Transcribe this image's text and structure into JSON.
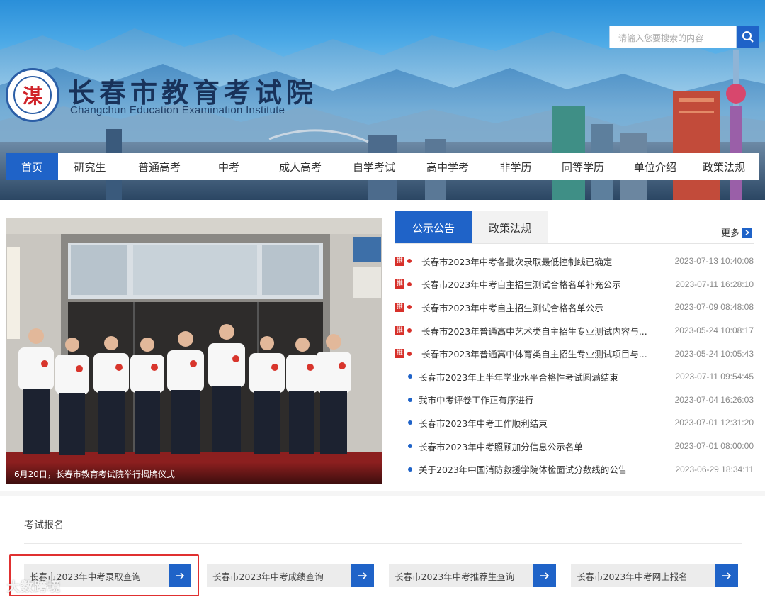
{
  "header": {
    "search_placeholder": "请输入您要搜索的内容",
    "title": "长春市教育考试院",
    "subtitle": "Changchun Education Examination Institute",
    "seal_char": "湈"
  },
  "nav": {
    "items": [
      "首页",
      "研究生",
      "普通高考",
      "中考",
      "成人高考",
      "自学考试",
      "高中学考",
      "非学历",
      "同等学历",
      "单位介绍",
      "政策法规"
    ],
    "active_index": 0
  },
  "photo": {
    "caption": "6月20日，长春市教育考试院举行揭牌仪式"
  },
  "news": {
    "tabs": [
      "公示公告",
      "政策法规"
    ],
    "active_tab": 0,
    "more_label": "更多",
    "badge_label": "推",
    "items": [
      {
        "title": "长春市2023年中考各批次录取最低控制线已确定",
        "date": "2023-07-13 10:40:08",
        "pinned": true
      },
      {
        "title": "长春市2023年中考自主招生测试合格名单补充公示",
        "date": "2023-07-11 16:28:10",
        "pinned": true
      },
      {
        "title": "长春市2023年中考自主招生测试合格名单公示",
        "date": "2023-07-09 08:48:08",
        "pinned": true
      },
      {
        "title": "长春市2023年普通高中艺术类自主招生专业测试内容与...",
        "date": "2023-05-24 10:08:17",
        "pinned": true
      },
      {
        "title": "长春市2023年普通高中体育类自主招生专业测试项目与...",
        "date": "2023-05-24 10:05:43",
        "pinned": true
      },
      {
        "title": "长春市2023年上半年学业水平合格性考试圆满结束",
        "date": "2023-07-11 09:54:45",
        "pinned": false
      },
      {
        "title": "我市中考评卷工作正有序进行",
        "date": "2023-07-04 16:26:03",
        "pinned": false
      },
      {
        "title": "长春市2023年中考工作顺利结束",
        "date": "2023-07-01 12:31:20",
        "pinned": false
      },
      {
        "title": "长春市2023年中考照顾加分信息公示名单",
        "date": "2023-07-01 08:00:00",
        "pinned": false
      },
      {
        "title": "关于2023年中国消防救援学院体检面试分数线的公告",
        "date": "2023-06-29 18:34:11",
        "pinned": false
      }
    ]
  },
  "exam": {
    "section_title": "考试报名",
    "links": [
      {
        "label": "长春市2023年中考录取查询"
      },
      {
        "label": "长春市2023年中考成绩查询"
      },
      {
        "label": "长春市2023年中考推荐生查询"
      },
      {
        "label": "长春市2023年中考网上报名"
      }
    ]
  },
  "watermark": "大数跨境",
  "colors": {
    "accent": "#1f63c8",
    "badge": "#d7302a",
    "highlight": "#e03030"
  }
}
